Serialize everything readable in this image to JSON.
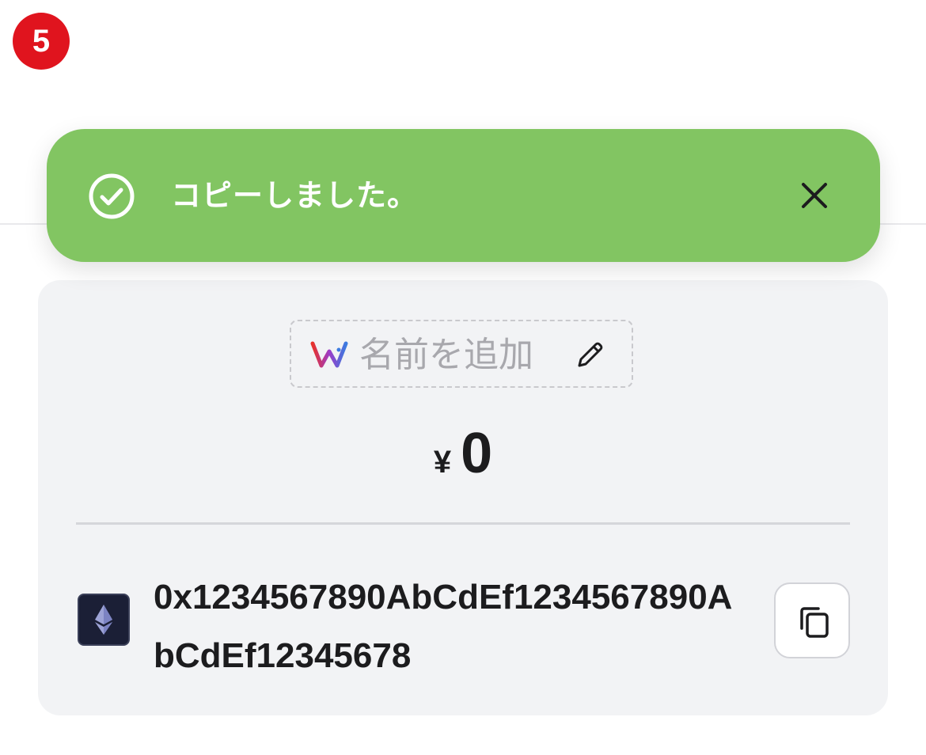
{
  "step_badge": "5",
  "toast": {
    "message": "コピーしました。",
    "status_color": "#82c562",
    "icons": {
      "status": "check-circle-icon",
      "close": "close-icon"
    }
  },
  "wallet": {
    "name_placeholder": "名前を追加",
    "logo": "wallet-logo",
    "edit_icon": "pencil-icon",
    "currency_symbol": "¥",
    "balance": "0",
    "network_icon": "ethereum-icon",
    "address": "0x1234567890AbCdEf1234567890AbCdEf12345678",
    "copy_icon": "copy-icon"
  }
}
